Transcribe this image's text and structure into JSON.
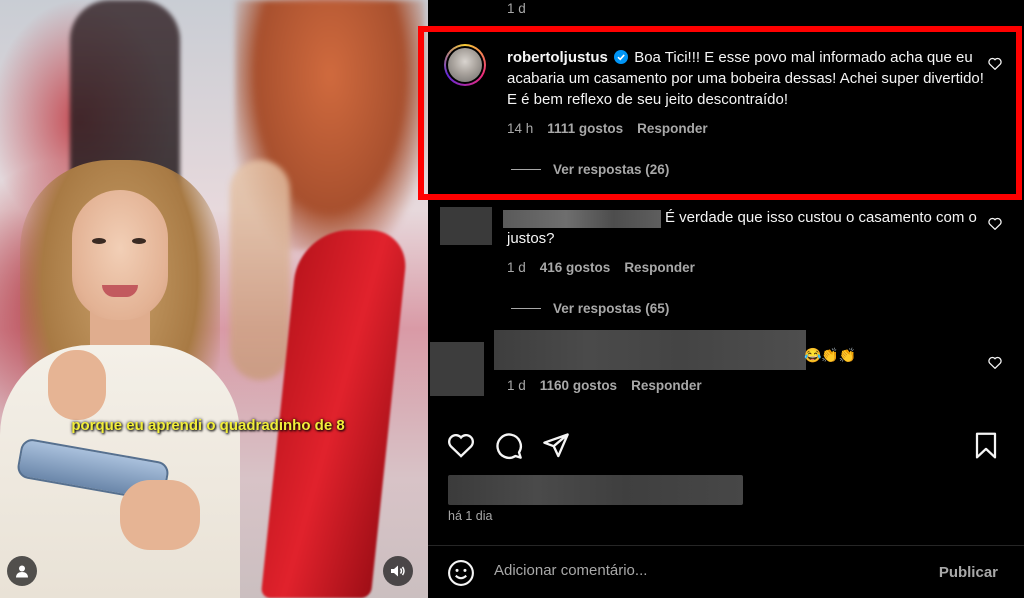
{
  "video": {
    "caption": "porque eu aprendi o quadradinho de 8"
  },
  "comments_panel": {
    "previous_comment_time": "1 d",
    "comments": [
      {
        "username": "robertoljustus",
        "verified": true,
        "text": "Boa Tici!!! E esse povo mal informado acha que eu acabaria um casamento por uma bobeira dessas! Achei super divertido! E é bem reflexo de seu jeito descontraído!",
        "time": "14 h",
        "likes": "1111 gostos",
        "reply_label": "Responder",
        "view_replies": "Ver respostas (26)"
      },
      {
        "username": "",
        "text": "É verdade que isso custou o casamento com o justos?",
        "time": "1 d",
        "likes": "416 gostos",
        "reply_label": "Responder",
        "view_replies": "Ver respostas (65)"
      },
      {
        "username": "",
        "text": "😂👏👏",
        "time": "1 d",
        "likes": "1160 gostos",
        "reply_label": "Responder"
      }
    ],
    "post_time": "há 1 dia",
    "comment_placeholder": "Adicionar comentário...",
    "publish_label": "Publicar"
  },
  "colors": {
    "highlight": "#ff0000",
    "background": "#000000",
    "text": "#f5f5f5",
    "secondary_text": "#a8a8a8",
    "verified": "#0095f6"
  },
  "icons": [
    "user-icon",
    "sound-icon",
    "heart-icon",
    "comment-icon",
    "share-icon",
    "bookmark-icon",
    "emoji-icon",
    "verified-badge-icon"
  ]
}
